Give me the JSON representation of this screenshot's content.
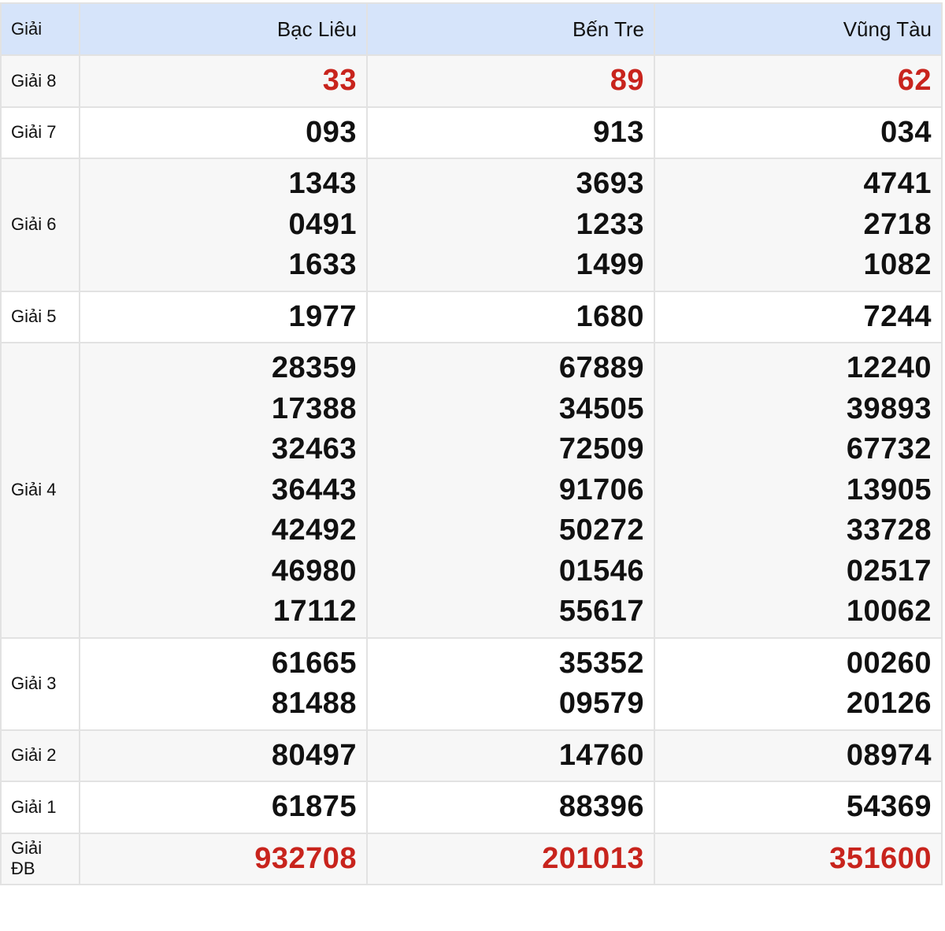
{
  "header": {
    "prize_label": "Giải",
    "provinces": [
      "Bạc Liêu",
      "Bến Tre",
      "Vũng Tàu"
    ]
  },
  "colors": {
    "header_bg": "#d6e4fa",
    "highlight_red": "#c8241d"
  },
  "rows": [
    {
      "label": "Giải 8",
      "highlight": true,
      "cols": [
        [
          "33"
        ],
        [
          "89"
        ],
        [
          "62"
        ]
      ]
    },
    {
      "label": "Giải 7",
      "highlight": false,
      "cols": [
        [
          "093"
        ],
        [
          "913"
        ],
        [
          "034"
        ]
      ]
    },
    {
      "label": "Giải 6",
      "highlight": false,
      "cols": [
        [
          "1343",
          "0491",
          "1633"
        ],
        [
          "3693",
          "1233",
          "1499"
        ],
        [
          "4741",
          "2718",
          "1082"
        ]
      ]
    },
    {
      "label": "Giải 5",
      "highlight": false,
      "cols": [
        [
          "1977"
        ],
        [
          "1680"
        ],
        [
          "7244"
        ]
      ]
    },
    {
      "label": "Giải 4",
      "highlight": false,
      "cols": [
        [
          "28359",
          "17388",
          "32463",
          "36443",
          "42492",
          "46980",
          "17112"
        ],
        [
          "67889",
          "34505",
          "72509",
          "91706",
          "50272",
          "01546",
          "55617"
        ],
        [
          "12240",
          "39893",
          "67732",
          "13905",
          "33728",
          "02517",
          "10062"
        ]
      ]
    },
    {
      "label": "Giải 3",
      "highlight": false,
      "cols": [
        [
          "61665",
          "81488"
        ],
        [
          "35352",
          "09579"
        ],
        [
          "00260",
          "20126"
        ]
      ]
    },
    {
      "label": "Giải 2",
      "highlight": false,
      "cols": [
        [
          "80497"
        ],
        [
          "14760"
        ],
        [
          "08974"
        ]
      ]
    },
    {
      "label": "Giải 1",
      "highlight": false,
      "cols": [
        [
          "61875"
        ],
        [
          "88396"
        ],
        [
          "54369"
        ]
      ]
    },
    {
      "label": "Giải ĐB",
      "highlight": true,
      "cols": [
        [
          "932708"
        ],
        [
          "201013"
        ],
        [
          "351600"
        ]
      ]
    }
  ]
}
